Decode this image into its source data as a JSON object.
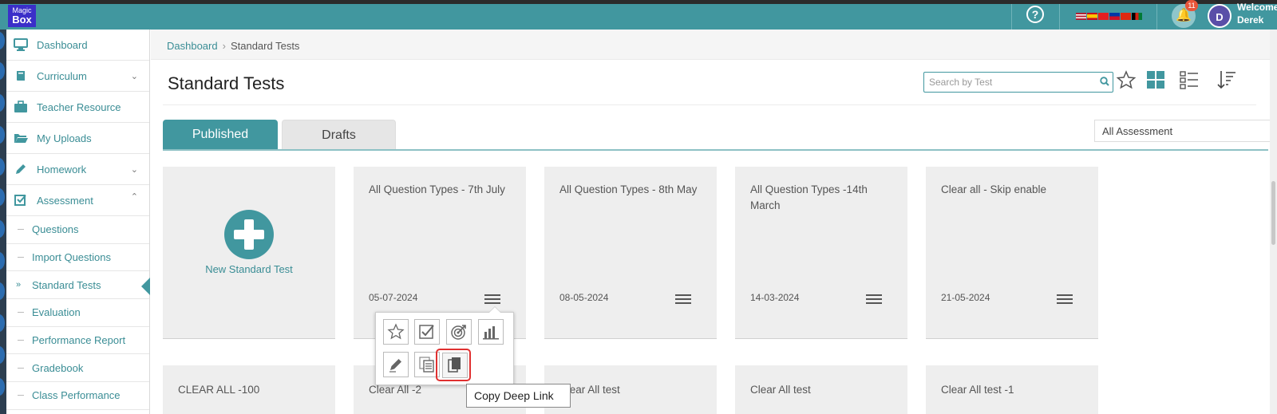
{
  "app": {
    "logo_top": "Magic",
    "logo_bottom": "Box",
    "help_glyph": "?",
    "notification_count": "11",
    "avatar_initial": "D",
    "welcome_label": "Welcome",
    "user_name": "Derek",
    "accent_color": "#41979f"
  },
  "sidebar": {
    "items": [
      {
        "label": "Dashboard",
        "icon": "monitor-icon"
      },
      {
        "label": "Curriculum",
        "icon": "book-icon"
      },
      {
        "label": "Teacher Resource",
        "icon": "briefcase-icon"
      },
      {
        "label": "My Uploads",
        "icon": "folder-open-icon"
      },
      {
        "label": "Homework",
        "icon": "pencil-icon"
      },
      {
        "label": "Assessment",
        "icon": "checkbox-icon"
      }
    ],
    "assessment_subitems": [
      "Questions",
      "Import Questions",
      "Standard Tests",
      "Evaluation",
      "Performance Report",
      "Gradebook",
      "Class Performance"
    ],
    "active_subitem": "Standard Tests"
  },
  "breadcrumb": {
    "root": "Dashboard",
    "current": "Standard Tests"
  },
  "page": {
    "title": "Standard Tests",
    "search_placeholder": "Search by Test"
  },
  "tabs": {
    "published": "Published",
    "drafts": "Drafts",
    "active": "Published"
  },
  "filter": {
    "selected": "All Assessment"
  },
  "new_test": {
    "label": "New Standard Test"
  },
  "tests_row1": [
    {
      "title": "All Question Types - 7th July",
      "date": "05-07-2024"
    },
    {
      "title": "All Question Types - 8th May",
      "date": "08-05-2024"
    },
    {
      "title": "All Question Types -14th March",
      "date": "14-03-2024"
    },
    {
      "title": "Clear all - Skip enable",
      "date": "21-05-2024"
    }
  ],
  "tests_row2": [
    {
      "title": "CLEAR ALL -100"
    },
    {
      "title": "Clear All -2"
    },
    {
      "title": "Clear All test"
    },
    {
      "title": "Clear All test"
    },
    {
      "title": "Clear All test -1"
    }
  ],
  "popover": {
    "actions": [
      "favorite-icon",
      "review-icon",
      "target-icon",
      "report-chart-icon",
      "edit-icon",
      "duplicate-icon",
      "copy-deep-link-icon"
    ],
    "tooltip": "Copy Deep Link"
  }
}
